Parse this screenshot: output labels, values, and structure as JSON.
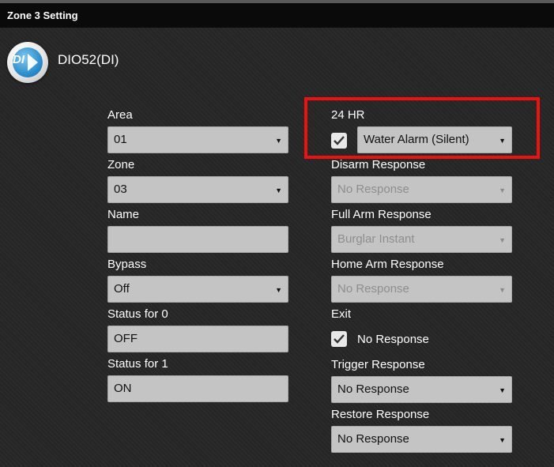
{
  "header": {
    "title": "Zone 3 Setting"
  },
  "device": {
    "icon_text": "DI",
    "name": "DIO52(DI)",
    "icon": "arrow-right-icon"
  },
  "left": {
    "area": {
      "label": "Area",
      "value": "01"
    },
    "zone": {
      "label": "Zone",
      "value": "03"
    },
    "name": {
      "label": "Name",
      "value": ""
    },
    "bypass": {
      "label": "Bypass",
      "value": "Off"
    },
    "status0": {
      "label": "Status for 0",
      "value": "OFF"
    },
    "status1": {
      "label": "Status for 1",
      "value": "ON"
    }
  },
  "right": {
    "hr24": {
      "label": "24 HR",
      "checked": true,
      "value": "Water Alarm (Silent)"
    },
    "disarm": {
      "label": "Disarm Response",
      "value": "No Response"
    },
    "full_arm": {
      "label": "Full Arm Response",
      "value": "Burglar Instant"
    },
    "home_arm": {
      "label": "Home Arm Response",
      "value": "No Response"
    },
    "exit": {
      "label": "Exit",
      "checked": true,
      "checkbox_label": "No Response"
    },
    "trigger": {
      "label": "Trigger Response",
      "value": "No Response"
    },
    "restore": {
      "label": "Restore Response",
      "value": "No Response"
    }
  },
  "colors": {
    "highlight": "#ee1111",
    "field_bg": "#c4c4c4",
    "header_bg": "#0a0a0a"
  }
}
